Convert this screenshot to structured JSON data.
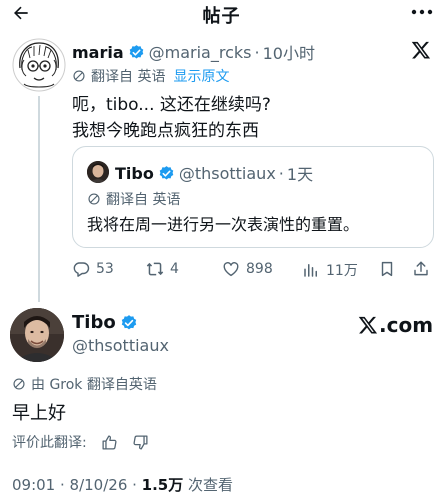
{
  "header": {
    "title": "帖子",
    "back_icon": "arrow-left-icon",
    "more_icon": "more-horizontal-icon"
  },
  "reply": {
    "author_name": "maria",
    "author_handle": "@maria_rcks",
    "separator": "·",
    "time": "10小时",
    "translate_label": "翻译自 英语",
    "show_original": "显示原文",
    "text_line1": "呃，tibo... 这还在继续吗?",
    "text_line2": "我想今晚跑点疯狂的东西",
    "quote": {
      "author_name": "Tibo",
      "author_handle": "@thsottiaux",
      "separator": "·",
      "time": "1天",
      "translate_label": "翻译自 英语",
      "text": "我将在周一进行另一次表演性的重置。"
    },
    "actions": {
      "replies": "53",
      "reposts": "4",
      "likes": "898",
      "views": "11万"
    }
  },
  "main_post": {
    "author_name": "Tibo",
    "author_handle": "@thsottiaux",
    "brand": ".com",
    "translate_label": "由 Grok 翻译自英语",
    "text": "早上好",
    "rate_label": "评价此翻译:",
    "time": "09:01 · 8/10/26 · ",
    "views_count": "1.5万",
    "views_label": " 次查看"
  },
  "colors": {
    "accent": "#1d9bf0",
    "muted": "#536471",
    "text": "#0f1419",
    "border": "#cfd9de"
  }
}
